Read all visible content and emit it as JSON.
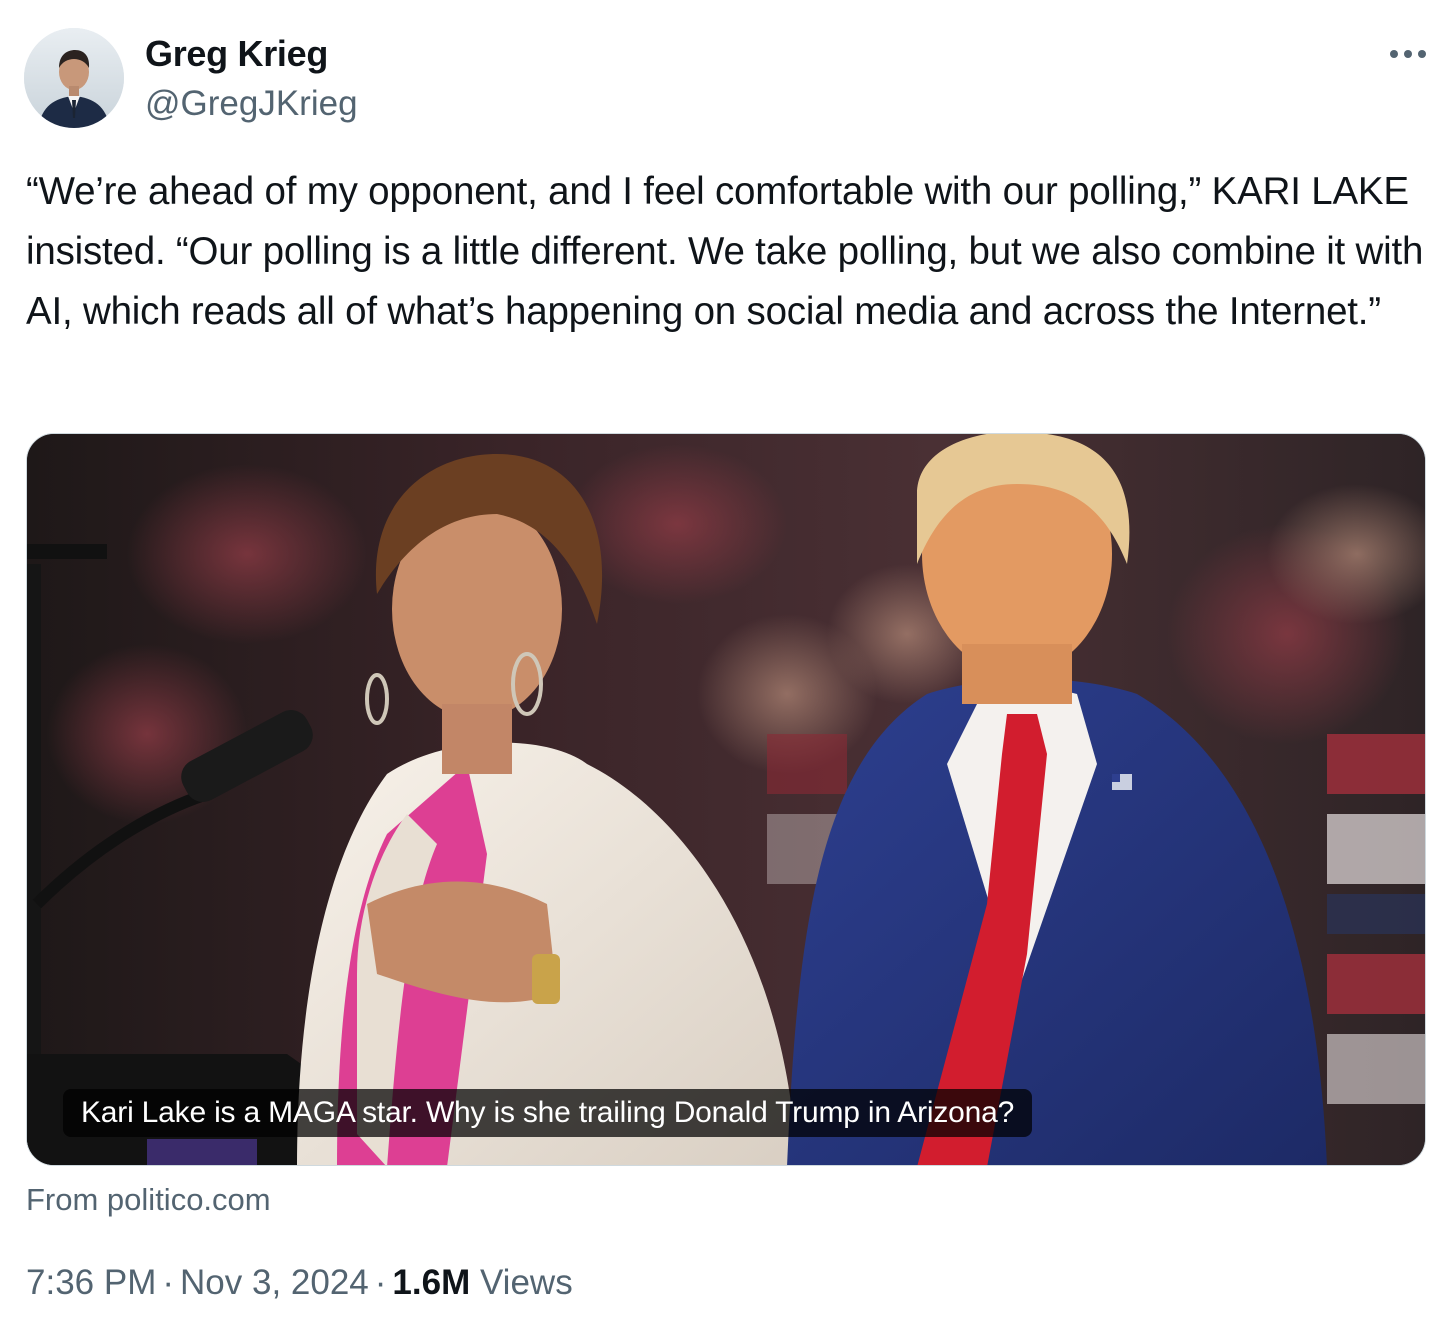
{
  "author": {
    "display_name": "Greg Krieg",
    "handle": "@GregJKrieg",
    "avatar_icon": "profile-photo"
  },
  "more_icon": "ellipsis-icon",
  "tweet": {
    "text": "“We’re ahead of my opponent, and I feel comfortable with our polling,” KARI LAKE insisted. “Our polling is a little different. We take polling, but we also combine it with AI, which reads all of what’s happening on social media and across the Internet.”"
  },
  "card": {
    "title": "Kari Lake is a MAGA star. Why is she trailing Donald Trump in Arizona?",
    "source": "From politico.com"
  },
  "meta": {
    "time": "7:36 PM",
    "separator": "·",
    "date": "Nov 3, 2024",
    "views_count": "1.6M",
    "views_label": "Views"
  },
  "colors": {
    "text_primary": "#0f1419",
    "text_secondary": "#536471",
    "border": "#cfd9de"
  }
}
